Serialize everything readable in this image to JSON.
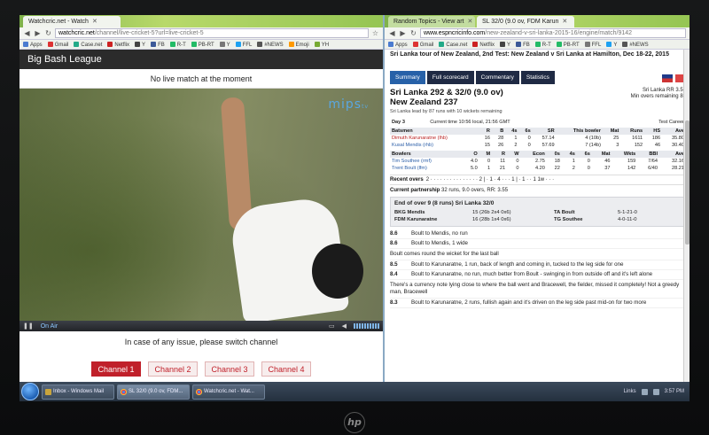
{
  "left_window": {
    "tab_title": "Watchcric.net - Watch",
    "url_host": "watchcric.net",
    "url_path": "/channel/live-cricket-5?url=live-cricket-5",
    "bookmarks": [
      "Apps",
      "Gmail",
      "Case.net",
      "Netflix",
      "Y",
      "FB",
      "R-T",
      "PB-RT",
      "Y",
      "FFL",
      "#NEWS",
      "Emoji",
      "YH"
    ],
    "header_title": "Big Bash League",
    "no_live_text": "No live match at the moment",
    "player_brand": "mips",
    "player_brand_suffix": "tv",
    "on_air_label": "On Air",
    "issue_text": "In case of any issue, please switch channel",
    "channels": [
      "Channel 1",
      "Channel 2",
      "Channel 3",
      "Channel 4"
    ],
    "active_channel": "Channel 1"
  },
  "right_window": {
    "tab_titles": [
      "Random Topics - View art",
      "SL 32/0 (9.0 ov, FDM Karun"
    ],
    "url_host": "www.espncricinfo.com",
    "url_path": "/new-zealand-v-sri-lanka-2015-16/engine/match/9142",
    "bookmarks": [
      "Apps",
      "Gmail",
      "Case.net",
      "Netflix",
      "Y",
      "FB",
      "R-T",
      "PB-RT",
      "FFL",
      "Y",
      "#NEWS"
    ],
    "page_title": "Sri Lanka tour of New Zealand, 2nd Test: New Zealand v Sri Lanka at Hamilton, Dec 18-22, 2015",
    "tabs": [
      "Summary",
      "Full scorecard",
      "Commentary",
      "Statistics"
    ],
    "score_line1": "Sri Lanka 292 & 32/0 (9.0 ov)",
    "score_line2": "New Zealand 237",
    "lead_text": "Sri Lanka lead by 87 runs with 10 wickets remaining",
    "run_rate": "Sri Lanka RR 3.55",
    "min_overs": "Min overs remaining 86",
    "day": "Day 3",
    "current_time": "Current time 10:56 local, 21:56 GMT",
    "this_bowler": "This bowler",
    "test_career": "Test Career",
    "batsmen_headers": [
      "Batsmen",
      "R",
      "B",
      "4s",
      "6s",
      "SR",
      "This bowler",
      "Mat",
      "Runs",
      "HS",
      "Ave"
    ],
    "batsmen": [
      [
        "Dimuth Karunaratne (lhb)",
        "16",
        "28",
        "1",
        "0",
        "57.14",
        "4 (10b)",
        "25",
        "1611",
        "186",
        "35.80"
      ],
      [
        "Kusal Mendis (rhb)",
        "15",
        "26",
        "2",
        "0",
        "57.69",
        "7 (14b)",
        "3",
        "152",
        "46",
        "30.40"
      ]
    ],
    "bowler_headers": [
      "Bowlers",
      "O",
      "M",
      "R",
      "W",
      "Econ",
      "0s",
      "4s",
      "6s",
      "Mat",
      "Wkts",
      "BBI",
      "Ave"
    ],
    "bowlers": [
      [
        "Tim Southee (rmf)",
        "4.0",
        "0",
        "11",
        "0",
        "2.75",
        "18",
        "1",
        "0",
        "46",
        "159",
        "7/64",
        "32.16"
      ],
      [
        "Trent Boult (lfm)",
        "5.0",
        "1",
        "21",
        "0",
        "4.20",
        "22",
        "2",
        "0",
        "37",
        "142",
        "6/40",
        "28.21"
      ]
    ],
    "recent_label": "Recent overs",
    "recent_overs": "2 · · · · · · · · · · · · · · · 2 | · 1 · 4 · · · 1 | · 1 · · 1 1w · · ·",
    "partnership_label": "Current partnership",
    "partnership_value": "32 runs, 9.0 overs, RR: 3.55",
    "end_of_over": "End of over 9 (8 runs)  Sri Lanka 32/0",
    "eoo_rows": [
      [
        "BKG Mendis",
        "15 (26b 2x4 0x6)",
        "TA Boult",
        "5-1-21-0"
      ],
      [
        "FDM Karunaratne",
        "16 (28b 1x4 0x6)",
        "TG Southee",
        "4-0-11-0"
      ]
    ],
    "commentary": [
      {
        "over": "8.6",
        "text": "Boult to Mendis, no run"
      },
      {
        "over": "8.6",
        "text": "Boult to Mendis, 1 wide"
      },
      {
        "over": "",
        "text": "Boult comes round the wicket for the last ball"
      },
      {
        "over": "8.5",
        "text": "Boult to Karunaratne, 1 run, back of length and coming in, tucked to the leg side for one"
      },
      {
        "over": "8.4",
        "text": "Boult to Karunaratne, no run, much better from Boult - swinging in from outside off and it's left alone"
      },
      {
        "over": "",
        "text": "There's a currency note lying close to where the ball went and Bracewell, the fielder, missed it completely! Not a greedy man, Bracewell"
      },
      {
        "over": "8.3",
        "text": "Boult to Karunaratne, 2 runs, fullish again and it's driven on the leg side past mid-on for two more"
      }
    ]
  },
  "taskbar": {
    "items": [
      "Inbox - Windows Mail",
      "SL 32/0 (9.0 ov, FDM...",
      "Watchcric.net - Wat..."
    ],
    "tray_links": "Links",
    "clock": "3:57 PM"
  },
  "colors": {
    "accent_red": "#c0202a",
    "tab_blue": "#2761a8",
    "chrome_green": "#95c553"
  }
}
